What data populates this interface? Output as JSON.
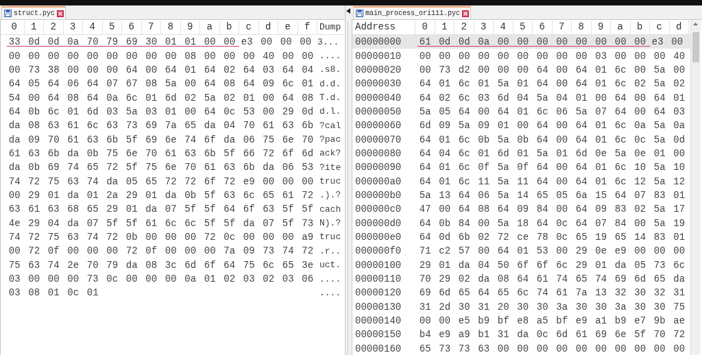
{
  "left_pane": {
    "tab": {
      "label": "struct.pyc",
      "selected": true
    },
    "columns": [
      "0",
      "1",
      "2",
      "3",
      "4",
      "5",
      "6",
      "7",
      "8",
      "9",
      "a",
      "b",
      "c",
      "d",
      "e",
      "f",
      "Dump"
    ],
    "rows": [
      {
        "annotated_bytes": [
          "33",
          "0d",
          "0d",
          "0a",
          "70",
          "79",
          "69",
          "30",
          "01",
          "01",
          "00",
          "00"
        ],
        "bytes": [
          "e3",
          "00",
          "00",
          "00"
        ],
        "dump": "3..."
      },
      {
        "bytes": [
          "00",
          "00",
          "00",
          "00",
          "00",
          "00",
          "00",
          "00",
          "00",
          "08",
          "00",
          "00",
          "00",
          "40",
          "00",
          "00"
        ],
        "dump": "...."
      },
      {
        "bytes": [
          "00",
          "73",
          "38",
          "00",
          "00",
          "00",
          "64",
          "00",
          "64",
          "01",
          "64",
          "02",
          "64",
          "03",
          "64",
          "04"
        ],
        "dump": ".s8."
      },
      {
        "bytes": [
          "64",
          "05",
          "64",
          "06",
          "64",
          "07",
          "67",
          "08",
          "5a",
          "00",
          "64",
          "08",
          "64",
          "09",
          "6c",
          "01"
        ],
        "dump": "d.d."
      },
      {
        "bytes": [
          "54",
          "00",
          "64",
          "08",
          "64",
          "0a",
          "6c",
          "01",
          "6d",
          "02",
          "5a",
          "02",
          "01",
          "00",
          "64",
          "08"
        ],
        "dump": "T.d."
      },
      {
        "bytes": [
          "64",
          "0b",
          "6c",
          "01",
          "6d",
          "03",
          "5a",
          "03",
          "01",
          "00",
          "64",
          "0c",
          "53",
          "00",
          "29",
          "0d"
        ],
        "dump": "d.l."
      },
      {
        "bytes": [
          "da",
          "08",
          "63",
          "61",
          "6c",
          "63",
          "73",
          "69",
          "7a",
          "65",
          "da",
          "04",
          "70",
          "61",
          "63",
          "6b"
        ],
        "dump": "?cal"
      },
      {
        "bytes": [
          "da",
          "09",
          "70",
          "61",
          "63",
          "6b",
          "5f",
          "69",
          "6e",
          "74",
          "6f",
          "da",
          "06",
          "75",
          "6e",
          "70"
        ],
        "dump": "?pac"
      },
      {
        "bytes": [
          "61",
          "63",
          "6b",
          "da",
          "0b",
          "75",
          "6e",
          "70",
          "61",
          "63",
          "6b",
          "5f",
          "66",
          "72",
          "6f",
          "6d"
        ],
        "dump": "ack?"
      },
      {
        "bytes": [
          "da",
          "0b",
          "69",
          "74",
          "65",
          "72",
          "5f",
          "75",
          "6e",
          "70",
          "61",
          "63",
          "6b",
          "da",
          "06",
          "53"
        ],
        "dump": "?ite"
      },
      {
        "bytes": [
          "74",
          "72",
          "75",
          "63",
          "74",
          "da",
          "05",
          "65",
          "72",
          "72",
          "6f",
          "72",
          "e9",
          "00",
          "00",
          "00"
        ],
        "dump": "truc"
      },
      {
        "bytes": [
          "00",
          "29",
          "01",
          "da",
          "01",
          "2a",
          "29",
          "01",
          "da",
          "0b",
          "5f",
          "63",
          "6c",
          "65",
          "61",
          "72"
        ],
        "dump": ".).?"
      },
      {
        "bytes": [
          "63",
          "61",
          "63",
          "68",
          "65",
          "29",
          "01",
          "da",
          "07",
          "5f",
          "5f",
          "64",
          "6f",
          "63",
          "5f",
          "5f"
        ],
        "dump": "cach"
      },
      {
        "bytes": [
          "4e",
          "29",
          "04",
          "da",
          "07",
          "5f",
          "5f",
          "61",
          "6c",
          "6c",
          "5f",
          "5f",
          "da",
          "07",
          "5f",
          "73"
        ],
        "dump": "N).?"
      },
      {
        "bytes": [
          "74",
          "72",
          "75",
          "63",
          "74",
          "72",
          "0b",
          "00",
          "00",
          "00",
          "72",
          "0c",
          "00",
          "00",
          "00",
          "a9"
        ],
        "dump": "truc"
      },
      {
        "bytes": [
          "00",
          "72",
          "0f",
          "00",
          "00",
          "00",
          "72",
          "0f",
          "00",
          "00",
          "00",
          "7a",
          "09",
          "73",
          "74",
          "72"
        ],
        "dump": ".r.."
      },
      {
        "bytes": [
          "75",
          "63",
          "74",
          "2e",
          "70",
          "79",
          "da",
          "08",
          "3c",
          "6d",
          "6f",
          "64",
          "75",
          "6c",
          "65",
          "3e"
        ],
        "dump": "uct."
      },
      {
        "bytes": [
          "03",
          "00",
          "00",
          "00",
          "73",
          "0c",
          "00",
          "00",
          "00",
          "0a",
          "01",
          "02",
          "03",
          "02",
          "03",
          "06"
        ],
        "dump": "...."
      },
      {
        "bytes": [
          "03",
          "08",
          "01",
          "0c",
          "01"
        ],
        "dump": "...."
      }
    ]
  },
  "right_pane": {
    "tab": {
      "label": "main_process_ori111.pyc",
      "selected": true
    },
    "columns": [
      "Address",
      "0",
      "1",
      "2",
      "3",
      "4",
      "5",
      "6",
      "7",
      "8",
      "9",
      "a",
      "b",
      "c",
      "d"
    ],
    "rows": [
      {
        "address": "00000000",
        "selected": true,
        "annotated_bytes": [
          "61",
          "0d",
          "0d",
          "0a",
          "00",
          "00",
          "00",
          "00",
          "00",
          "00",
          "00",
          "00"
        ],
        "bytes": [
          "e3",
          "00"
        ]
      },
      {
        "address": "00000010",
        "selected": false,
        "bytes": [
          "00",
          "00",
          "00",
          "00",
          "00",
          "00",
          "00",
          "00",
          "00",
          "03",
          "00",
          "00",
          "00",
          "40"
        ]
      },
      {
        "address": "00000020",
        "selected": false,
        "bytes": [
          "00",
          "73",
          "d2",
          "00",
          "00",
          "00",
          "64",
          "00",
          "64",
          "01",
          "6c",
          "00",
          "5a",
          "00"
        ]
      },
      {
        "address": "00000030",
        "selected": false,
        "bytes": [
          "64",
          "01",
          "6c",
          "01",
          "5a",
          "01",
          "64",
          "00",
          "64",
          "01",
          "6c",
          "02",
          "5a",
          "02"
        ]
      },
      {
        "address": "00000040",
        "selected": false,
        "bytes": [
          "64",
          "02",
          "6c",
          "03",
          "6d",
          "04",
          "5a",
          "04",
          "01",
          "00",
          "64",
          "00",
          "64",
          "01"
        ]
      },
      {
        "address": "00000050",
        "selected": false,
        "bytes": [
          "5a",
          "05",
          "64",
          "00",
          "64",
          "01",
          "6c",
          "06",
          "5a",
          "07",
          "64",
          "00",
          "64",
          "03"
        ]
      },
      {
        "address": "00000060",
        "selected": false,
        "bytes": [
          "6d",
          "09",
          "5a",
          "09",
          "01",
          "00",
          "64",
          "00",
          "64",
          "01",
          "6c",
          "0a",
          "5a",
          "0a"
        ]
      },
      {
        "address": "00000070",
        "selected": false,
        "bytes": [
          "64",
          "01",
          "6c",
          "0b",
          "5a",
          "0b",
          "64",
          "00",
          "64",
          "01",
          "6c",
          "0c",
          "5a",
          "0d"
        ]
      },
      {
        "address": "00000080",
        "selected": false,
        "bytes": [
          "64",
          "04",
          "6c",
          "01",
          "6d",
          "01",
          "5a",
          "01",
          "6d",
          "0e",
          "5a",
          "0e",
          "01",
          "00"
        ]
      },
      {
        "address": "00000090",
        "selected": false,
        "bytes": [
          "64",
          "01",
          "6c",
          "0f",
          "5a",
          "0f",
          "64",
          "00",
          "64",
          "01",
          "6c",
          "10",
          "5a",
          "10"
        ]
      },
      {
        "address": "000000a0",
        "selected": false,
        "bytes": [
          "64",
          "01",
          "6c",
          "11",
          "5a",
          "11",
          "64",
          "00",
          "64",
          "01",
          "6c",
          "12",
          "5a",
          "12"
        ]
      },
      {
        "address": "000000b0",
        "selected": false,
        "bytes": [
          "5a",
          "13",
          "64",
          "06",
          "5a",
          "14",
          "65",
          "05",
          "6a",
          "15",
          "64",
          "07",
          "83",
          "01"
        ]
      },
      {
        "address": "000000c0",
        "selected": false,
        "bytes": [
          "47",
          "00",
          "64",
          "08",
          "64",
          "09",
          "84",
          "00",
          "64",
          "09",
          "83",
          "02",
          "5a",
          "17"
        ]
      },
      {
        "address": "000000d0",
        "selected": false,
        "bytes": [
          "64",
          "0b",
          "84",
          "00",
          "5a",
          "18",
          "64",
          "0c",
          "64",
          "07",
          "84",
          "00",
          "5a",
          "19"
        ]
      },
      {
        "address": "000000e0",
        "selected": false,
        "bytes": [
          "64",
          "0d",
          "6b",
          "02",
          "72",
          "ce",
          "78",
          "0c",
          "65",
          "19",
          "65",
          "14",
          "83",
          "01"
        ]
      },
      {
        "address": "000000f0",
        "selected": false,
        "bytes": [
          "71",
          "c2",
          "57",
          "00",
          "64",
          "01",
          "53",
          "00",
          "29",
          "0e",
          "e9",
          "00",
          "00",
          "00"
        ]
      },
      {
        "address": "00000100",
        "selected": false,
        "bytes": [
          "29",
          "01",
          "da",
          "04",
          "50",
          "6f",
          "6f",
          "6c",
          "29",
          "01",
          "da",
          "05",
          "73",
          "6c"
        ]
      },
      {
        "address": "00000110",
        "selected": false,
        "bytes": [
          "70",
          "29",
          "02",
          "da",
          "08",
          "64",
          "61",
          "74",
          "65",
          "74",
          "69",
          "6d",
          "65",
          "da"
        ]
      },
      {
        "address": "00000120",
        "selected": false,
        "bytes": [
          "69",
          "6d",
          "65",
          "64",
          "65",
          "6c",
          "74",
          "61",
          "7a",
          "13",
          "32",
          "30",
          "32",
          "31"
        ]
      },
      {
        "address": "00000130",
        "selected": false,
        "bytes": [
          "31",
          "2d",
          "30",
          "31",
          "20",
          "30",
          "30",
          "3a",
          "30",
          "30",
          "3a",
          "30",
          "30",
          "75"
        ]
      },
      {
        "address": "00000140",
        "selected": false,
        "bytes": [
          "00",
          "00",
          "e5",
          "b9",
          "bf",
          "e8",
          "a5",
          "bf",
          "e9",
          "a1",
          "b9",
          "e7",
          "9b",
          "ae"
        ]
      },
      {
        "address": "00000150",
        "selected": false,
        "bytes": [
          "b4",
          "e9",
          "a9",
          "b1",
          "31",
          "da",
          "0c",
          "6d",
          "61",
          "69",
          "6e",
          "5f",
          "70",
          "72"
        ]
      },
      {
        "address": "00000160",
        "selected": false,
        "bytes": [
          "65",
          "73",
          "73",
          "63",
          "00",
          "00",
          "00",
          "00",
          "00",
          "00",
          "00",
          "00",
          "00",
          "00"
        ]
      }
    ]
  }
}
